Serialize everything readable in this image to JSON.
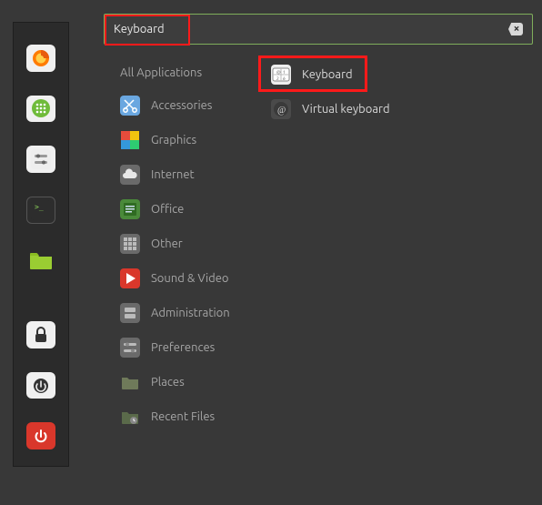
{
  "search": {
    "value": "Keyboard"
  },
  "launcher": [
    {
      "name": "firefox"
    },
    {
      "name": "contacts"
    },
    {
      "name": "settings"
    },
    {
      "name": "terminal"
    },
    {
      "name": "files"
    },
    {
      "name": "lock"
    },
    {
      "name": "logout"
    },
    {
      "name": "power"
    }
  ],
  "categories": {
    "all": "All Applications",
    "items": [
      {
        "label": "Accessories"
      },
      {
        "label": "Graphics"
      },
      {
        "label": "Internet"
      },
      {
        "label": "Office"
      },
      {
        "label": "Other"
      },
      {
        "label": "Sound & Video"
      },
      {
        "label": "Administration"
      },
      {
        "label": "Preferences"
      },
      {
        "label": "Places"
      },
      {
        "label": "Recent Files"
      }
    ]
  },
  "results": [
    {
      "label": "Keyboard",
      "highlighted": true
    },
    {
      "label": "Virtual keyboard",
      "highlighted": false
    }
  ]
}
